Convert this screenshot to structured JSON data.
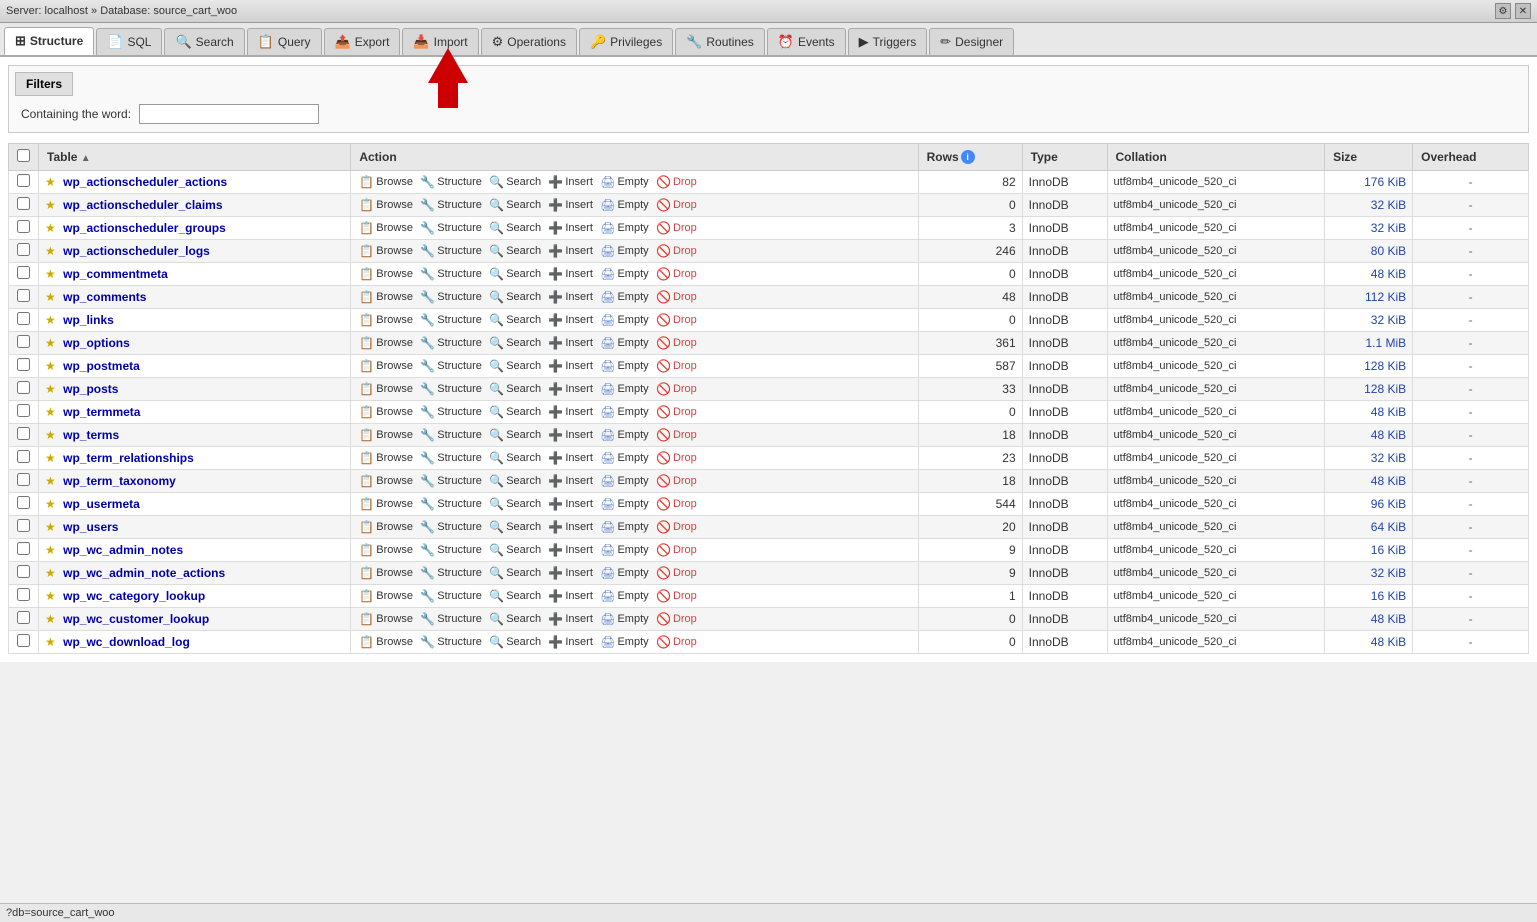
{
  "titlebar": {
    "server": "Server: localhost",
    "separator": "»",
    "database": "Database: source_cart_woo"
  },
  "tabs": [
    {
      "id": "structure",
      "label": "Structure",
      "icon": "⊞",
      "active": true
    },
    {
      "id": "sql",
      "label": "SQL",
      "icon": "📄"
    },
    {
      "id": "search",
      "label": "Search",
      "icon": "🔍"
    },
    {
      "id": "query",
      "label": "Query",
      "icon": "📋"
    },
    {
      "id": "export",
      "label": "Export",
      "icon": "📤"
    },
    {
      "id": "import",
      "label": "Import",
      "icon": "📥"
    },
    {
      "id": "operations",
      "label": "Operations",
      "icon": "⚙"
    },
    {
      "id": "privileges",
      "label": "Privileges",
      "icon": "🔑"
    },
    {
      "id": "routines",
      "label": "Routines",
      "icon": "🔧"
    },
    {
      "id": "events",
      "label": "Events",
      "icon": "⏰"
    },
    {
      "id": "triggers",
      "label": "Triggers",
      "icon": "▶"
    },
    {
      "id": "designer",
      "label": "Designer",
      "icon": "✏"
    }
  ],
  "filters": {
    "toggle_label": "Filters",
    "label": "Containing the word:",
    "input_value": "",
    "input_placeholder": ""
  },
  "columns": {
    "table": "Table",
    "action": "Action",
    "rows": "Rows",
    "type": "Type",
    "collation": "Collation",
    "size": "Size",
    "overhead": "Overhead"
  },
  "action_labels": {
    "browse": "Browse",
    "structure": "Structure",
    "search": "Search",
    "insert": "Insert",
    "empty": "Empty",
    "drop": "Drop"
  },
  "tables": [
    {
      "name": "wp_actionscheduler_actions",
      "rows": 82,
      "type": "InnoDB",
      "collation": "utf8mb4_unicode_520_ci",
      "size": "176 KiB",
      "overhead": "-"
    },
    {
      "name": "wp_actionscheduler_claims",
      "rows": 0,
      "type": "InnoDB",
      "collation": "utf8mb4_unicode_520_ci",
      "size": "32 KiB",
      "overhead": "-"
    },
    {
      "name": "wp_actionscheduler_groups",
      "rows": 3,
      "type": "InnoDB",
      "collation": "utf8mb4_unicode_520_ci",
      "size": "32 KiB",
      "overhead": "-"
    },
    {
      "name": "wp_actionscheduler_logs",
      "rows": 246,
      "type": "InnoDB",
      "collation": "utf8mb4_unicode_520_ci",
      "size": "80 KiB",
      "overhead": "-"
    },
    {
      "name": "wp_commentmeta",
      "rows": 0,
      "type": "InnoDB",
      "collation": "utf8mb4_unicode_520_ci",
      "size": "48 KiB",
      "overhead": "-"
    },
    {
      "name": "wp_comments",
      "rows": 48,
      "type": "InnoDB",
      "collation": "utf8mb4_unicode_520_ci",
      "size": "112 KiB",
      "overhead": "-"
    },
    {
      "name": "wp_links",
      "rows": 0,
      "type": "InnoDB",
      "collation": "utf8mb4_unicode_520_ci",
      "size": "32 KiB",
      "overhead": "-"
    },
    {
      "name": "wp_options",
      "rows": 361,
      "type": "InnoDB",
      "collation": "utf8mb4_unicode_520_ci",
      "size": "1.1 MiB",
      "overhead": "-"
    },
    {
      "name": "wp_postmeta",
      "rows": 587,
      "type": "InnoDB",
      "collation": "utf8mb4_unicode_520_ci",
      "size": "128 KiB",
      "overhead": "-"
    },
    {
      "name": "wp_posts",
      "rows": 33,
      "type": "InnoDB",
      "collation": "utf8mb4_unicode_520_ci",
      "size": "128 KiB",
      "overhead": "-"
    },
    {
      "name": "wp_termmeta",
      "rows": 0,
      "type": "InnoDB",
      "collation": "utf8mb4_unicode_520_ci",
      "size": "48 KiB",
      "overhead": "-"
    },
    {
      "name": "wp_terms",
      "rows": 18,
      "type": "InnoDB",
      "collation": "utf8mb4_unicode_520_ci",
      "size": "48 KiB",
      "overhead": "-"
    },
    {
      "name": "wp_term_relationships",
      "rows": 23,
      "type": "InnoDB",
      "collation": "utf8mb4_unicode_520_ci",
      "size": "32 KiB",
      "overhead": "-"
    },
    {
      "name": "wp_term_taxonomy",
      "rows": 18,
      "type": "InnoDB",
      "collation": "utf8mb4_unicode_520_ci",
      "size": "48 KiB",
      "overhead": "-"
    },
    {
      "name": "wp_usermeta",
      "rows": 544,
      "type": "InnoDB",
      "collation": "utf8mb4_unicode_520_ci",
      "size": "96 KiB",
      "overhead": "-"
    },
    {
      "name": "wp_users",
      "rows": 20,
      "type": "InnoDB",
      "collation": "utf8mb4_unicode_520_ci",
      "size": "64 KiB",
      "overhead": "-"
    },
    {
      "name": "wp_wc_admin_notes",
      "rows": 9,
      "type": "InnoDB",
      "collation": "utf8mb4_unicode_520_ci",
      "size": "16 KiB",
      "overhead": "-"
    },
    {
      "name": "wp_wc_admin_note_actions",
      "rows": 9,
      "type": "InnoDB",
      "collation": "utf8mb4_unicode_520_ci",
      "size": "32 KiB",
      "overhead": "-"
    },
    {
      "name": "wp_wc_category_lookup",
      "rows": 1,
      "type": "InnoDB",
      "collation": "utf8mb4_unicode_520_ci",
      "size": "16 KiB",
      "overhead": "-"
    },
    {
      "name": "wp_wc_customer_lookup",
      "rows": 0,
      "type": "InnoDB",
      "collation": "utf8mb4_unicode_520_ci",
      "size": "48 KiB",
      "overhead": "-"
    },
    {
      "name": "wp_wc_download_log",
      "rows": 0,
      "type": "InnoDB",
      "collation": "utf8mb4_unicode_520_ci",
      "size": "48 KiB",
      "overhead": "-"
    }
  ],
  "statusbar": {
    "text": "?db=source_cart_woo"
  }
}
